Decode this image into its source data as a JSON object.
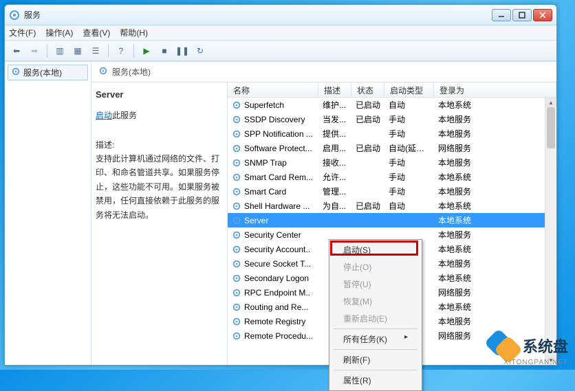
{
  "window": {
    "title": "服务"
  },
  "menu": {
    "file": "文件(F)",
    "action": "操作(A)",
    "view": "查看(V)",
    "help": "帮助(H)"
  },
  "tree": {
    "root": "服务(本地)"
  },
  "header": {
    "label": "服务(本地)"
  },
  "detail": {
    "name": "Server",
    "start_link": "启动",
    "start_rest": "此服务",
    "desc_label": "描述:",
    "desc_text": "支持此计算机通过网络的文件、打印、和命名管道共享。如果服务停止，这些功能不可用。如果服务被禁用，任何直接依赖于此服务的服务将无法启动。"
  },
  "columns": {
    "name": "名称",
    "desc": "描述",
    "status": "状态",
    "startup": "启动类型",
    "logon": "登录为"
  },
  "services": [
    {
      "name": "Superfetch",
      "desc": "维护...",
      "status": "已启动",
      "startup": "自动",
      "logon": "本地系统"
    },
    {
      "name": "SSDP Discovery",
      "desc": "当发...",
      "status": "已启动",
      "startup": "手动",
      "logon": "本地服务"
    },
    {
      "name": "SPP Notification ...",
      "desc": "提供...",
      "status": "",
      "startup": "手动",
      "logon": "本地服务"
    },
    {
      "name": "Software Protect...",
      "desc": "启用...",
      "status": "已启动",
      "startup": "自动(延迟...",
      "logon": "网络服务"
    },
    {
      "name": "SNMP Trap",
      "desc": "接收...",
      "status": "",
      "startup": "手动",
      "logon": "本地服务"
    },
    {
      "name": "Smart Card Rem...",
      "desc": "允许...",
      "status": "",
      "startup": "手动",
      "logon": "本地系统"
    },
    {
      "name": "Smart Card",
      "desc": "管理...",
      "status": "",
      "startup": "手动",
      "logon": "本地服务"
    },
    {
      "name": "Shell Hardware ...",
      "desc": "为自...",
      "status": "已启动",
      "startup": "自动",
      "logon": "本地系统"
    },
    {
      "name": "Server",
      "desc": "",
      "status": "",
      "startup": "",
      "logon": "本地系统",
      "selected": true
    },
    {
      "name": "Security Center",
      "desc": "",
      "status": "",
      "startup": "",
      "logon": "本地服务"
    },
    {
      "name": "Security Account..",
      "desc": "",
      "status": "",
      "startup": "",
      "logon": "本地系统"
    },
    {
      "name": "Secure Socket T...",
      "desc": "",
      "status": "",
      "startup": "",
      "logon": "本地服务"
    },
    {
      "name": "Secondary Logon",
      "desc": "",
      "status": "",
      "startup": "",
      "logon": "本地系统"
    },
    {
      "name": "RPC Endpoint M..",
      "desc": "",
      "status": "",
      "startup": "",
      "logon": "网络服务"
    },
    {
      "name": "Routing and Re...",
      "desc": "",
      "status": "",
      "startup": "",
      "logon": "本地系统"
    },
    {
      "name": "Remote Registry",
      "desc": "",
      "status": "",
      "startup": "",
      "logon": "本地服务"
    },
    {
      "name": "Remote Procedu...",
      "desc": "",
      "status": "",
      "startup": "",
      "logon": "网络服务"
    }
  ],
  "context_menu": {
    "start": "启动(S)",
    "stop": "停止(O)",
    "pause": "暂停(U)",
    "resume": "恢复(M)",
    "restart": "重新启动(E)",
    "all_tasks": "所有任务(K)",
    "refresh": "刷新(F)",
    "properties": "属性(R)"
  },
  "watermark": {
    "text": "系统盘",
    "url": "XITONGPAN.NET"
  }
}
